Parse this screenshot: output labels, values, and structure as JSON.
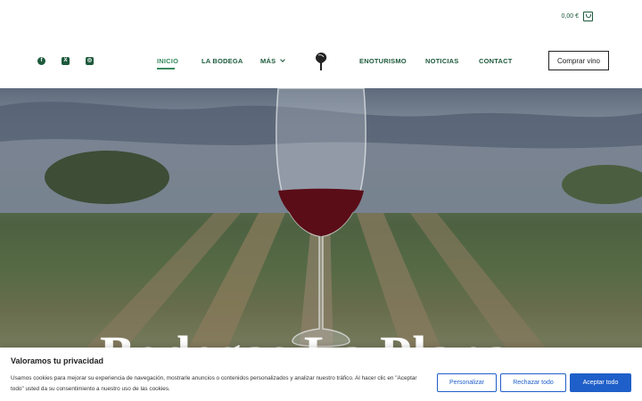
{
  "header": {
    "cart_total": "0,00 €",
    "nav": {
      "inicio": "INICIO",
      "bodega": "LA BODEGA",
      "mas": "MÁS",
      "enoturismo": "ENOTURISMO",
      "noticias": "NOTICIAS",
      "contact": "CONTACT"
    },
    "buy_button": "Comprar vino",
    "social_icons": [
      "facebook-icon",
      "x-icon",
      "instagram-icon"
    ]
  },
  "hero": {
    "title": "Bodegas La Plana"
  },
  "cookie_banner": {
    "title": "Valoramos tu privacidad",
    "text": "Usamos cookies para mejorar su experiencia de navegación, mostrarle anuncios o contenidos personalizados y analizar nuestro tráfico. Al hacer clic en \"Aceptar todo\" usted da su consentimiento a nuestro uso de las cookies.",
    "personalize": "Personalizar",
    "reject": "Rechazar todo",
    "accept": "Aceptar todo"
  },
  "colors": {
    "brand_green": "#1d5a3c",
    "active_green": "#3a8a5f",
    "cookie_blue": "#1f5fc9"
  }
}
